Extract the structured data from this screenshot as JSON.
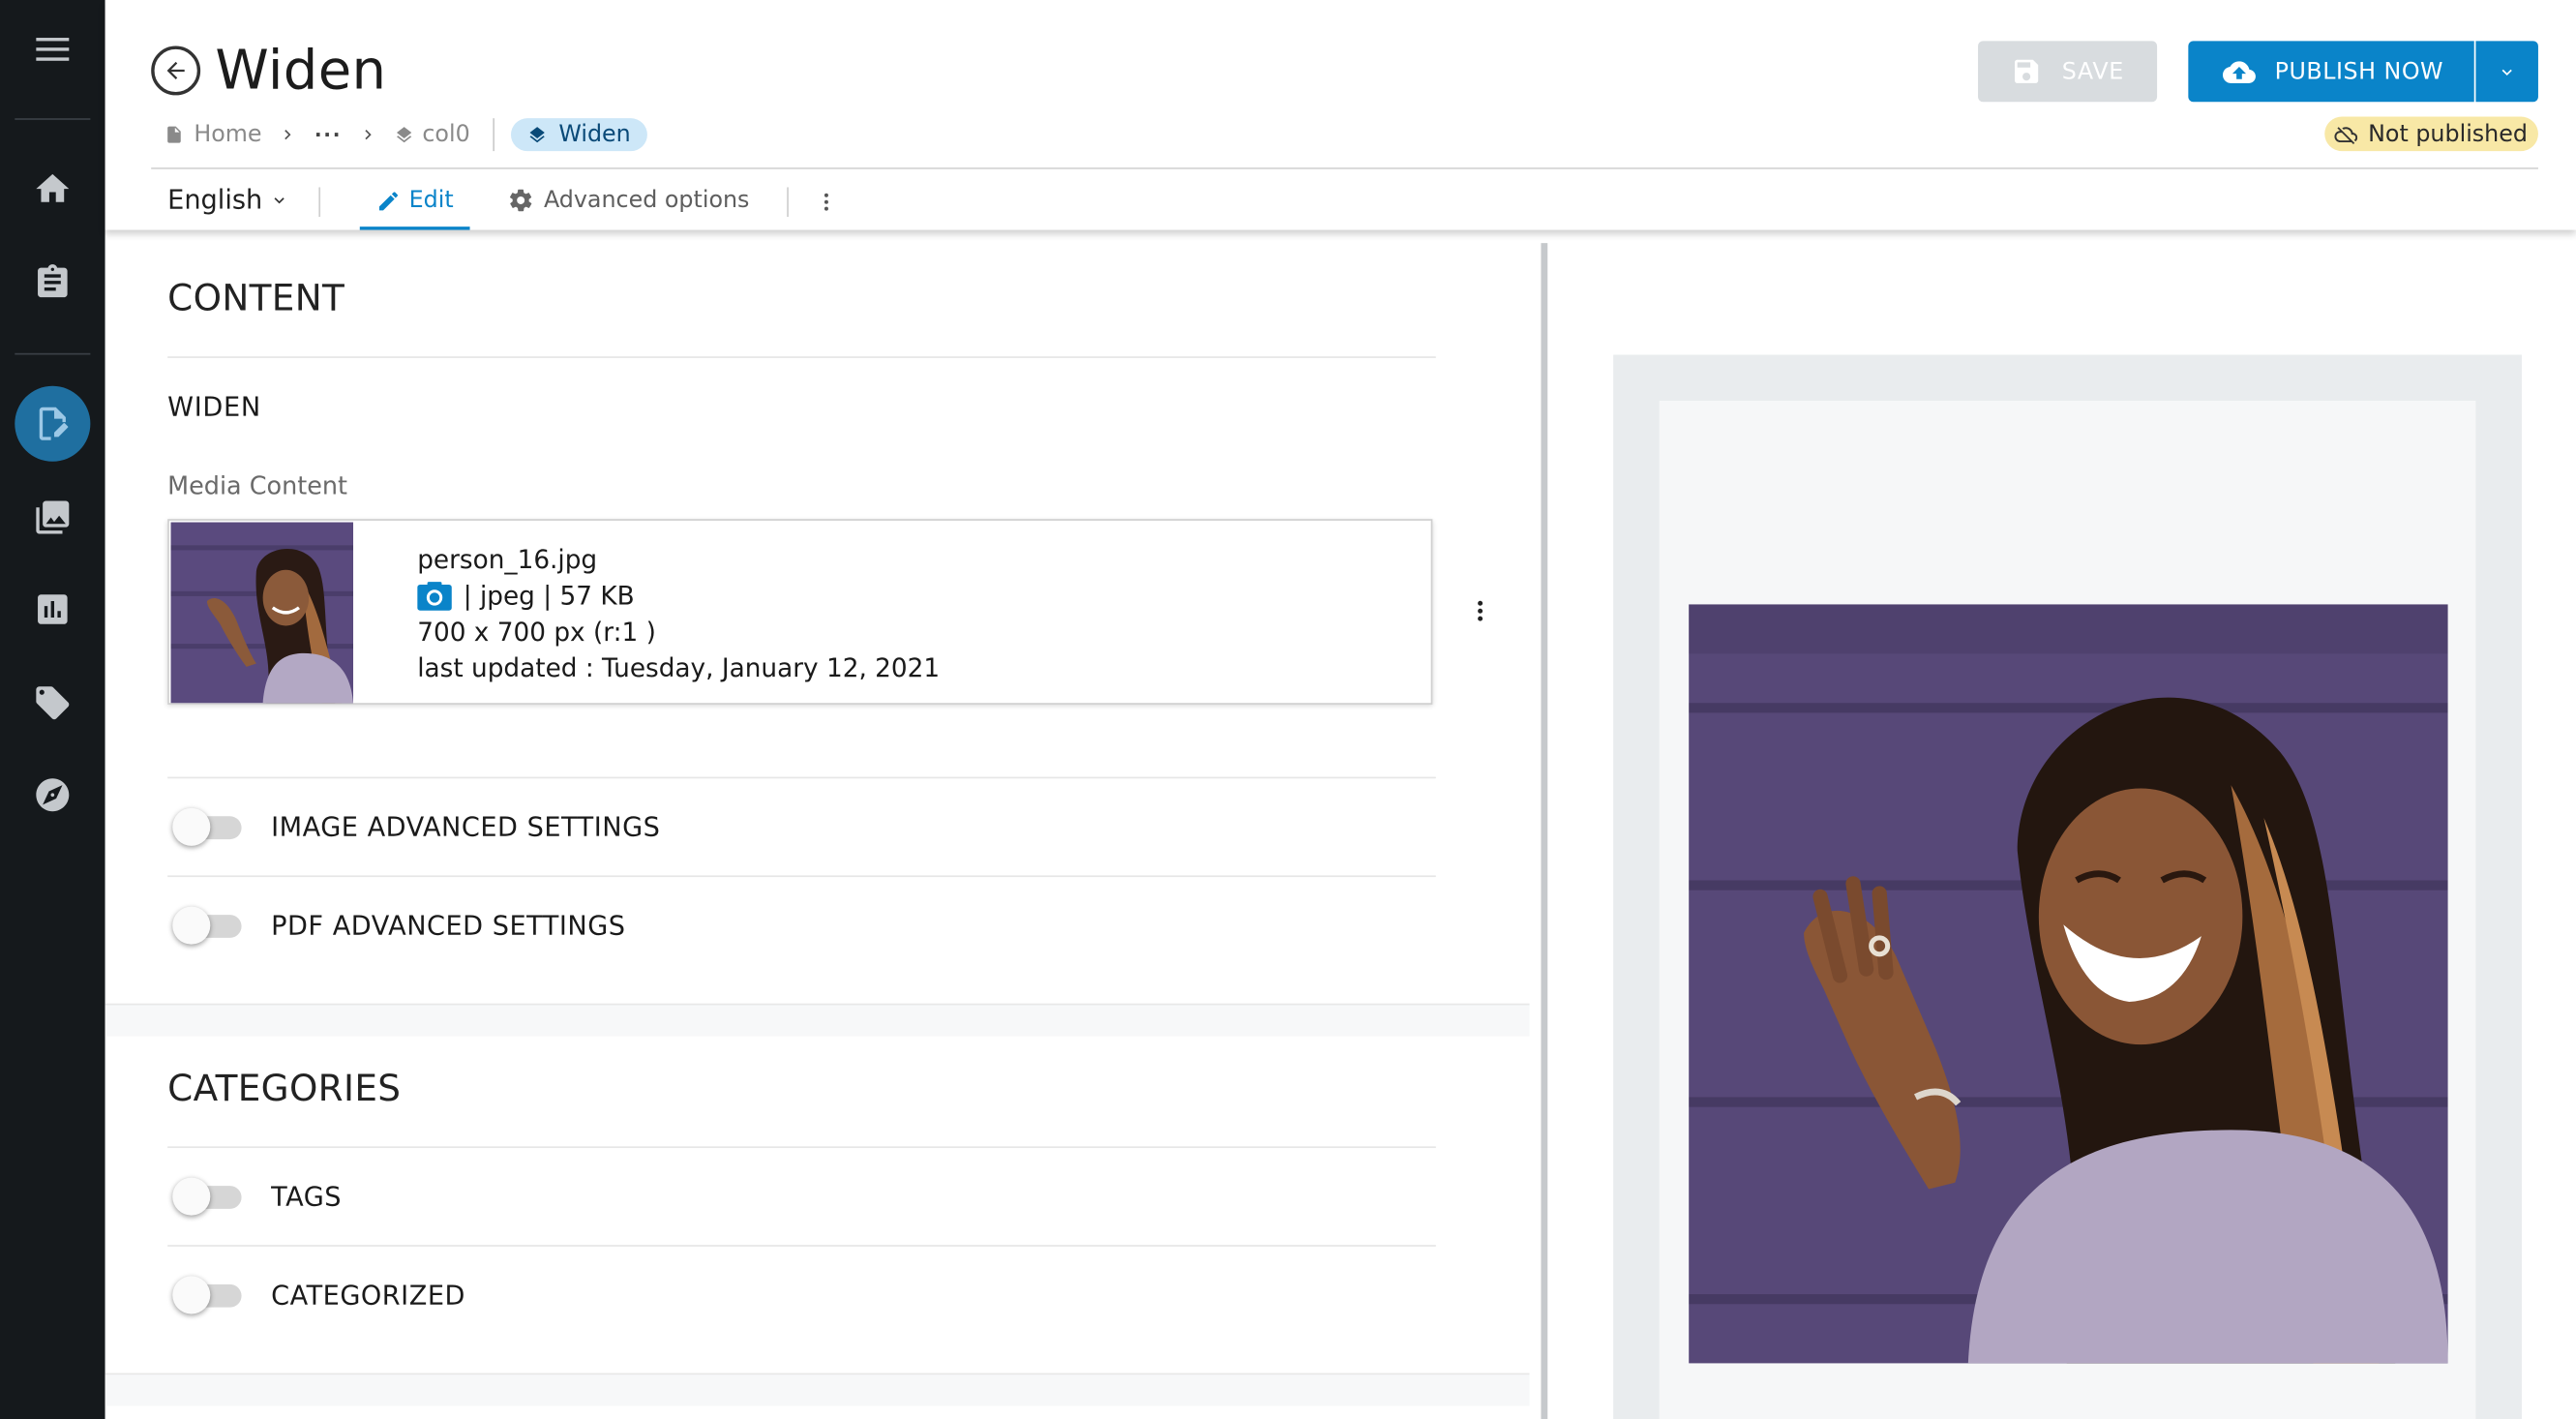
{
  "sidebar": {
    "items": [
      {
        "icon": "menu-icon"
      },
      {
        "icon": "home-icon"
      },
      {
        "icon": "clipboard-icon"
      },
      {
        "icon": "content-edit-icon",
        "active": true
      },
      {
        "icon": "image-library-icon"
      },
      {
        "icon": "bar-chart-icon"
      },
      {
        "icon": "tag-icon"
      },
      {
        "icon": "compass-icon"
      }
    ],
    "colors": {
      "background": "#15191c",
      "active": "#1f6fa0"
    }
  },
  "header": {
    "title": "Widen",
    "breadcrumb": {
      "home": "Home",
      "ellipsis": "···",
      "folder": "col0",
      "current": "Widen"
    },
    "save_label": "SAVE",
    "publish_label": "PUBLISH NOW",
    "status": "Not published",
    "colors": {
      "primary": "#0a84c9",
      "status_bg": "#f8e8a6",
      "disabled": "#d8dcdf"
    }
  },
  "toolbar": {
    "language": "English",
    "tab_edit": "Edit",
    "tab_advanced": "Advanced options"
  },
  "content": {
    "section_title": "CONTENT",
    "component_label": "WIDEN",
    "media_label": "Media Content",
    "media": {
      "filename": "person_16.jpg",
      "type_size": "| jpeg | 57 KB",
      "dimensions": "700 x 700 px (r:1 )",
      "updated": "last updated : Tuesday, January 12, 2021"
    },
    "toggles": [
      {
        "label": "IMAGE ADVANCED SETTINGS",
        "on": false
      },
      {
        "label": "PDF ADVANCED SETTINGS",
        "on": false
      }
    ]
  },
  "categories": {
    "section_title": "CATEGORIES",
    "toggles": [
      {
        "label": "TAGS",
        "on": false
      },
      {
        "label": "CATEGORIZED",
        "on": false
      }
    ]
  }
}
